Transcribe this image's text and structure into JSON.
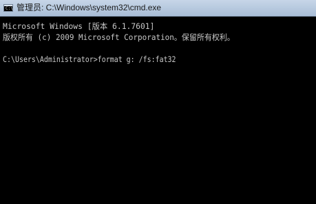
{
  "window": {
    "title": "管理员: C:\\Windows\\system32\\cmd.exe",
    "icon": "cmd-icon",
    "icon_prompt": "C:\\"
  },
  "console": {
    "lines": [
      "Microsoft Windows [版本 6.1.7601]",
      "版权所有 (c) 2009 Microsoft Corporation。保留所有权利。",
      "",
      "C:\\Users\\Administrator>format g: /fs:fat32"
    ]
  },
  "colors": {
    "console_background": "#000000",
    "console_text": "#c8c8c8",
    "titlebar": "#b9cbe0"
  }
}
